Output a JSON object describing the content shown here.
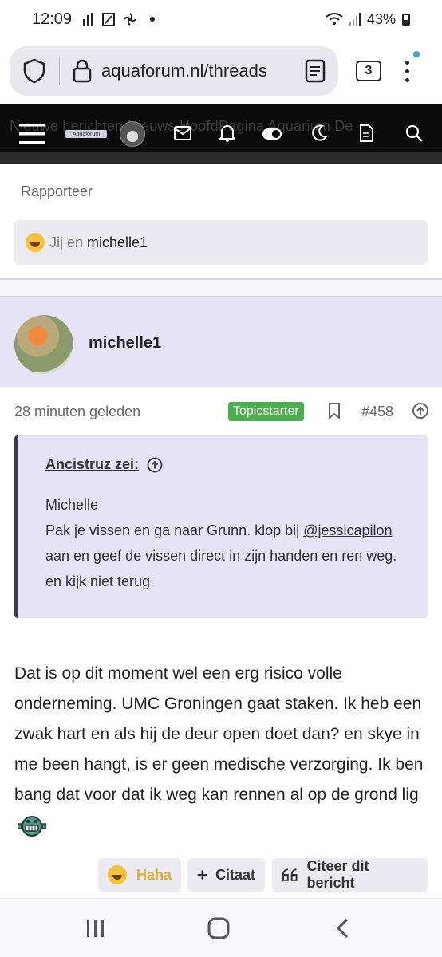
{
  "status_bar": {
    "time": "12:09",
    "battery": "43%"
  },
  "browser": {
    "url": "aquaforum.nl/threads",
    "tab_count": "3"
  },
  "site_nav": {
    "background_text": "Nieuwe berichten   Nieuws   HoofdPagina   Aquarium De",
    "logo_text": "Aquaforum"
  },
  "post_prev": {
    "report_label": "Rapporteer",
    "reactions_prefix": "Jij en",
    "reactions_user": "michelle1"
  },
  "post": {
    "username": "michelle1",
    "time_ago": "28 minuten geleden",
    "badge": "Topicstarter",
    "post_number": "#458",
    "quote": {
      "author": "Ancistruz zei:",
      "line1": "Michelle",
      "line2_pre": "Pak je vissen en ga naar Grunn. klop bij ",
      "mention": "@jessicapilon",
      "line2_post": " aan en geef de vissen direct in zijn handen en ren weg. en kijk niet terug."
    },
    "body": "Dat is op dit moment wel een erg risico volle onderneming. UMC Groningen gaat staken. Ik heb een zwak hart en als hij de deur open doet dan? en skye in me been hangt, is er geen medische verzorging. Ik ben bang dat voor dat ik weg kan rennen al op de grond lig",
    "actions": {
      "haha": "Haha",
      "quote": "Citaat",
      "reply": "Citeer dit bericht"
    }
  },
  "colors": {
    "badge_green": "#4cae4f",
    "user_band": "#e6e3f7",
    "nav_dark": "#0b0b0b",
    "haha_orange": "#e6a93a"
  }
}
